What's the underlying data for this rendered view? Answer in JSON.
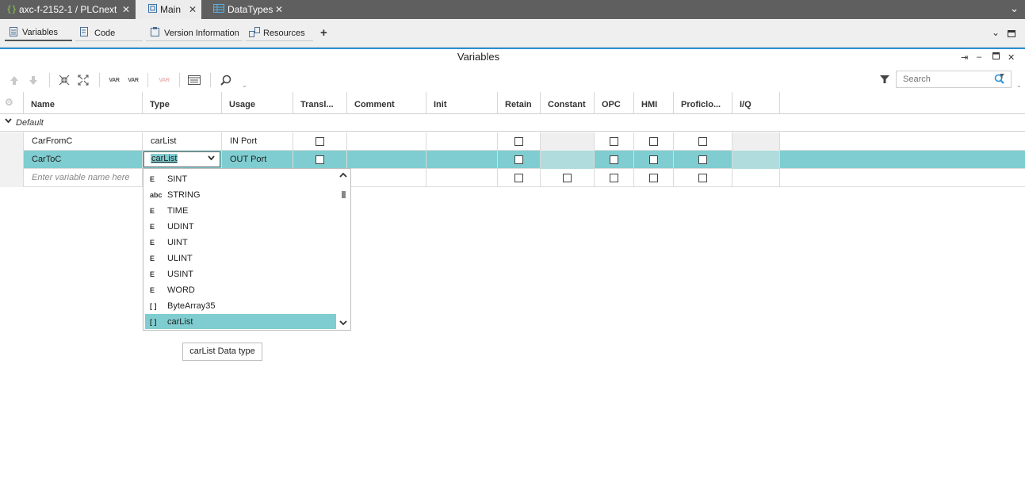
{
  "doc_tabs": [
    {
      "label": "axc-f-2152-1 / PLCnext",
      "icon": "device-icon",
      "active": false
    },
    {
      "label": "Main",
      "icon": "program-icon",
      "active": true
    },
    {
      "label": "DataTypes",
      "icon": "table-icon",
      "active": false
    }
  ],
  "editor_tabs": [
    {
      "label": "Variables",
      "icon": "variables-icon",
      "active": true
    },
    {
      "label": "Code",
      "icon": "code-icon"
    },
    {
      "label": "Version Information",
      "icon": "clipboard-icon"
    },
    {
      "label": "Resources",
      "icon": "resources-icon"
    }
  ],
  "panel": {
    "title": "Variables"
  },
  "toolbar": {
    "var_label": "VAR",
    "search_placeholder": "Search"
  },
  "columns": [
    "Name",
    "Type",
    "Usage",
    "Transl...",
    "Comment",
    "Init",
    "Retain",
    "Constant",
    "OPC",
    "HMI",
    "Proficlo...",
    "I/Q"
  ],
  "group": {
    "label": "Default"
  },
  "rows": [
    {
      "name": "CarFromC",
      "type": "carList",
      "usage": "IN Port"
    },
    {
      "name": "CarToC",
      "type": "carList",
      "usage": "OUT Port"
    },
    {
      "name": "Enter variable name here",
      "type": "",
      "usage": ""
    }
  ],
  "type_editor": {
    "value": "carList"
  },
  "dropdown": {
    "items": [
      {
        "label": "SINT",
        "icon": "elementary-type-icon"
      },
      {
        "label": "STRING",
        "icon": "string-type-icon"
      },
      {
        "label": "TIME",
        "icon": "elementary-type-icon"
      },
      {
        "label": "UDINT",
        "icon": "elementary-type-icon"
      },
      {
        "label": "UINT",
        "icon": "elementary-type-icon"
      },
      {
        "label": "ULINT",
        "icon": "elementary-type-icon"
      },
      {
        "label": "USINT",
        "icon": "elementary-type-icon"
      },
      {
        "label": "WORD",
        "icon": "elementary-type-icon"
      },
      {
        "label": "ByteArray35",
        "icon": "array-type-icon"
      },
      {
        "label": "carList",
        "icon": "array-type-icon",
        "selected": true
      }
    ],
    "icon_text": {
      "elementary": "E",
      "string": "abc",
      "array": "[ ]"
    }
  },
  "tooltip": {
    "text": "carList Data type"
  },
  "colors": {
    "accent": "#2a8fd4",
    "selection": "#7fcdd0",
    "tabbar": "#5f5f5f"
  }
}
